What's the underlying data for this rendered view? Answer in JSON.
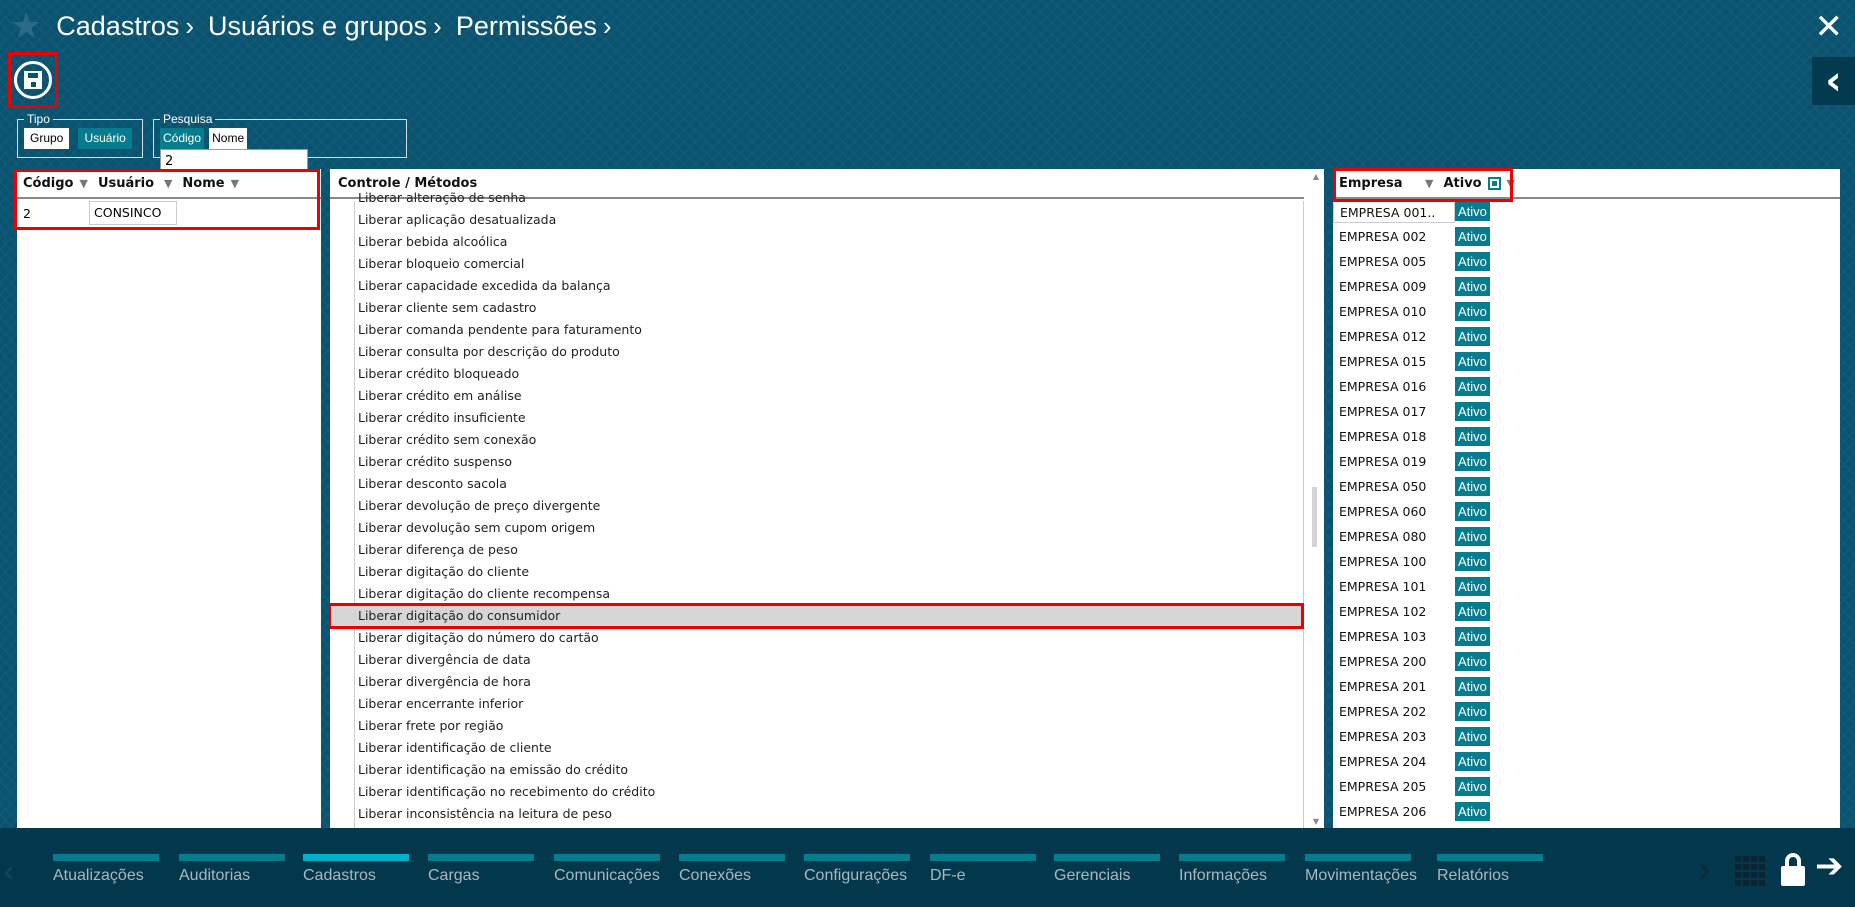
{
  "breadcrumb": [
    "Cadastros",
    "Usuários e grupos",
    "Permissões"
  ],
  "tipo": {
    "legend": "Tipo",
    "options": [
      "Grupo",
      "Usuário"
    ],
    "selected": "Usuário"
  },
  "pesquisa": {
    "legend": "Pesquisa",
    "options": [
      "Código",
      "Nome"
    ],
    "selected": "Código",
    "value": "2"
  },
  "users": {
    "columns": [
      "Código",
      "Usuário",
      "Nome"
    ],
    "rows": [
      {
        "codigo": "2",
        "usuario": "CONSINCO",
        "nome": ""
      }
    ]
  },
  "controles": {
    "header": "Controle / Métodos",
    "selected": "Liberar digitação do consumidor",
    "items": [
      "Liberar alteração de senha",
      "Liberar aplicação desatualizada",
      "Liberar bebida alcoólica",
      "Liberar bloqueio comercial",
      "Liberar capacidade excedida da balança",
      "Liberar cliente sem cadastro",
      "Liberar comanda pendente para faturamento",
      "Liberar consulta por descrição do produto",
      "Liberar crédito bloqueado",
      "Liberar crédito em análise",
      "Liberar crédito insuficiente",
      "Liberar crédito sem conexão",
      "Liberar crédito suspenso",
      "Liberar desconto sacola",
      "Liberar devolução de preço divergente",
      "Liberar devolução sem cupom origem",
      "Liberar diferença de peso",
      "Liberar digitação do cliente",
      "Liberar digitação do cliente recompensa",
      "Liberar digitação do consumidor",
      "Liberar digitação do número do cartão",
      "Liberar divergência de data",
      "Liberar divergência de hora",
      "Liberar encerrante inferior",
      "Liberar frete por região",
      "Liberar identificação de cliente",
      "Liberar identificação na emissão do crédito",
      "Liberar identificação no recebimento do crédito",
      "Liberar inconsistência na leitura de peso"
    ]
  },
  "empresas": {
    "columns": [
      "Empresa",
      "Ativo"
    ],
    "status_label": "Ativo",
    "items": [
      "EMPRESA 001..",
      "EMPRESA 002",
      "EMPRESA 005",
      "EMPRESA 009",
      "EMPRESA 010",
      "EMPRESA 012",
      "EMPRESA 015",
      "EMPRESA 016",
      "EMPRESA 017",
      "EMPRESA 018",
      "EMPRESA 019",
      "EMPRESA 050",
      "EMPRESA 060",
      "EMPRESA 080",
      "EMPRESA 100",
      "EMPRESA 101",
      "EMPRESA 102",
      "EMPRESA 103",
      "EMPRESA 200",
      "EMPRESA 201",
      "EMPRESA 202",
      "EMPRESA 203",
      "EMPRESA 204",
      "EMPRESA 205",
      "EMPRESA 206"
    ]
  },
  "nav": {
    "active": "Cadastros",
    "tabs": [
      "Atualizações",
      "Auditorias",
      "Cadastros",
      "Cargas",
      "Comunicações",
      "Conexões",
      "Configurações",
      "DF-e",
      "Gerenciais",
      "Informações",
      "Movimentações",
      "Relatórios"
    ]
  },
  "colors": {
    "background": "#0a5370",
    "bottom": "#03374b",
    "accent": "#087c8f",
    "active_tab": "#00aecd",
    "highlight": "#ee0000"
  }
}
